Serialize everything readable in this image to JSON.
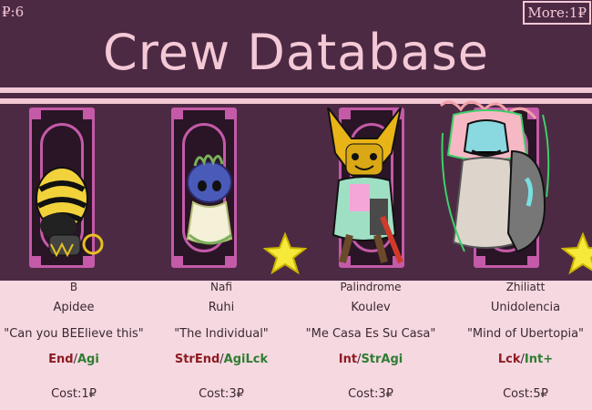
{
  "header": {
    "currency": "₽:6",
    "more_button": "More:1₽",
    "title": "Crew Database"
  },
  "crew": [
    {
      "name": "B",
      "species": "Apidee",
      "quote": "\"Can you BEElieve this\"",
      "stat_good": "End",
      "stat_bad": "Agi",
      "cost": "Cost:1₽",
      "starred": false
    },
    {
      "name": "Nafi",
      "species": "Ruhi",
      "quote": "\"The Individual\"",
      "stat_good": "StrEnd",
      "stat_bad": "AgiLck",
      "cost": "Cost:3₽",
      "starred": true
    },
    {
      "name": "Palindrome",
      "species": "Koulev",
      "quote": "\"Me Casa Es Su Casa\"",
      "stat_good": "Int",
      "stat_bad": "StrAgi",
      "cost": "Cost:3₽",
      "starred": false
    },
    {
      "name": "Zhiliatt",
      "species": "Unidolencia",
      "quote": "\"Mind of Ubertopia\"",
      "stat_good": "Lck",
      "stat_bad": "Int+",
      "cost": "Cost:5₽",
      "starred": true
    }
  ],
  "colors": {
    "background": "#4d2a44",
    "accent_pink": "#f4c9d6",
    "frame_magenta": "#c45aa8",
    "panel": "#f6d8e1",
    "buff_red": "#8c1c22",
    "debuff_green": "#2e7d32",
    "star_yellow": "#f7e93a"
  },
  "icons": [
    "star-icon"
  ]
}
